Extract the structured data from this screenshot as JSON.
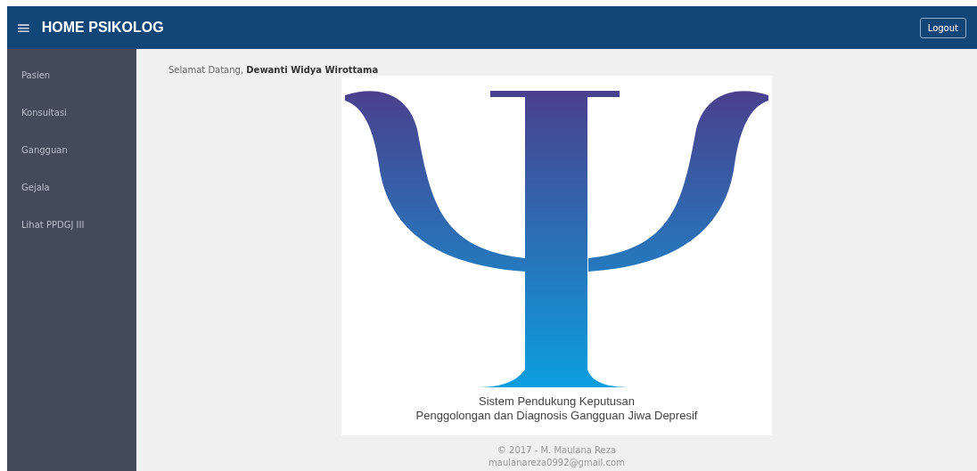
{
  "header": {
    "menu_icon": "≡",
    "title": "HOME PSIKOLOG",
    "logout_button": "Logout"
  },
  "sidebar": {
    "items": [
      {
        "label": "Pasien"
      },
      {
        "label": "Konsultasi"
      },
      {
        "label": "Gangguan"
      },
      {
        "label": "Gejala"
      },
      {
        "label": "Lihat PPDGJ III"
      }
    ]
  },
  "welcome": "Selamat Datang, **Dewanti Widya Wirottama**",
  "banner": {
    "caption": [
      "Sistem Pendukung Keputusan",
      "Penggolongan dan Diagnosis Gangguan Jiwa Depresif"
    ]
  },
  "footer": [
    "© 2017 - M. Maulana Reza",
    "maulanareza0992@gmail.com"
  ]
}
